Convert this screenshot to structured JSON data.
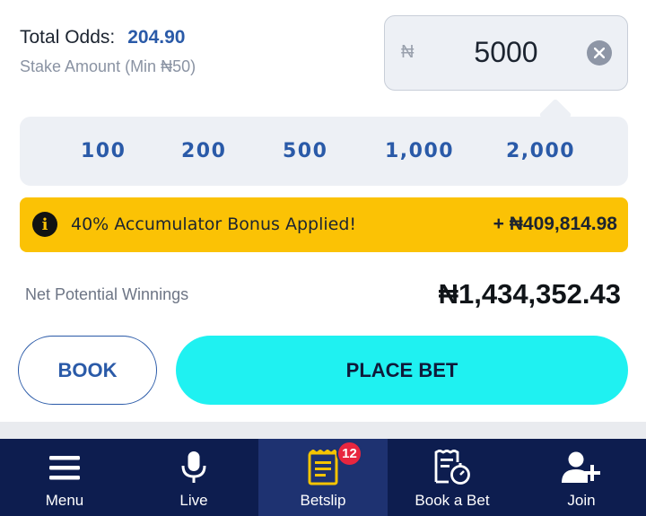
{
  "odds": {
    "label": "Total Odds:",
    "value": "204.90"
  },
  "stake": {
    "label": "Stake Amount (Min ₦50)",
    "currency_symbol": "₦",
    "value": "5000",
    "clear_icon": "close-circle-icon"
  },
  "quick_amounts": [
    "100",
    "200",
    "500",
    "1,000",
    "2,000"
  ],
  "bonus": {
    "icon": "info-icon",
    "text": "40% Accumulator Bonus Applied!",
    "amount": "+ ₦409,814.98",
    "color": "#fbc205"
  },
  "net": {
    "label": "Net Potential Winnings",
    "amount": "₦1,434,352.43"
  },
  "actions": {
    "book_label": "BOOK",
    "place_bet_label": "PLACE BET",
    "place_bet_color": "#1ff1f1"
  },
  "nav": {
    "items": [
      {
        "label": "Menu",
        "icon": "hamburger-menu-icon"
      },
      {
        "label": "Live",
        "icon": "microphone-icon"
      },
      {
        "label": "Betslip",
        "icon": "betslip-icon",
        "active": true
      },
      {
        "label": "Book a Bet",
        "icon": "book-a-bet-icon"
      },
      {
        "label": "Join",
        "icon": "add-user-icon"
      }
    ],
    "betslip_badge": "12",
    "background": "#0d1d4f"
  }
}
